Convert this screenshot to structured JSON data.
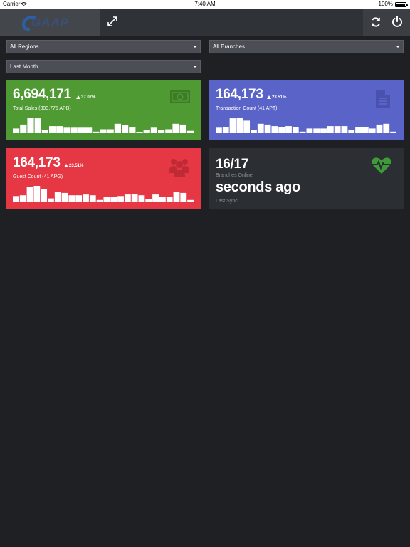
{
  "status_bar": {
    "carrier": "Carrier",
    "time": "7:40 AM",
    "battery": "100%"
  },
  "header": {
    "logo_text": "GAAP"
  },
  "filters": {
    "region": "All Regions",
    "branch": "All Branches",
    "period": "Last Month"
  },
  "cards": {
    "sales": {
      "value": "6,694,171",
      "change": "37.07%",
      "label": "Total Sales (393,775 APB)",
      "bars": [
        0.3,
        0.55,
        1.0,
        0.95,
        0.2,
        0.45,
        0.45,
        0.35,
        0.35,
        0.35,
        0.35,
        0.1,
        0.25,
        0.25,
        0.6,
        0.5,
        0.4,
        0.05,
        0.2,
        0.35,
        0.2,
        0.25,
        0.6,
        0.55,
        0.15
      ]
    },
    "transactions": {
      "value": "164,173",
      "change": "23.51%",
      "label": "Transaction Count (41 APT)",
      "bars": [
        0.35,
        0.4,
        0.95,
        1.0,
        0.8,
        0.2,
        0.6,
        0.55,
        0.45,
        0.4,
        0.45,
        0.4,
        0.1,
        0.3,
        0.3,
        0.3,
        0.45,
        0.45,
        0.45,
        0.2,
        0.4,
        0.4,
        0.3,
        0.55,
        0.6,
        0.1
      ]
    },
    "guests": {
      "value": "164,173",
      "change": "23.51%",
      "label": "Guest Count (41 APG)",
      "bars": [
        0.35,
        0.4,
        0.95,
        1.0,
        0.8,
        0.2,
        0.6,
        0.55,
        0.4,
        0.4,
        0.45,
        0.4,
        0.1,
        0.3,
        0.3,
        0.35,
        0.45,
        0.5,
        0.4,
        0.15,
        0.45,
        0.3,
        0.3,
        0.6,
        0.55,
        0.1
      ]
    },
    "branches": {
      "value": "16/17",
      "label": "Branches Online",
      "last_sync_value": "seconds ago",
      "last_sync_label": "Last Sync"
    }
  },
  "colors": {
    "sales": "#4f9a33",
    "transactions": "#5a63c7",
    "guests": "#e63844",
    "pulse": "#3f9b3a"
  }
}
